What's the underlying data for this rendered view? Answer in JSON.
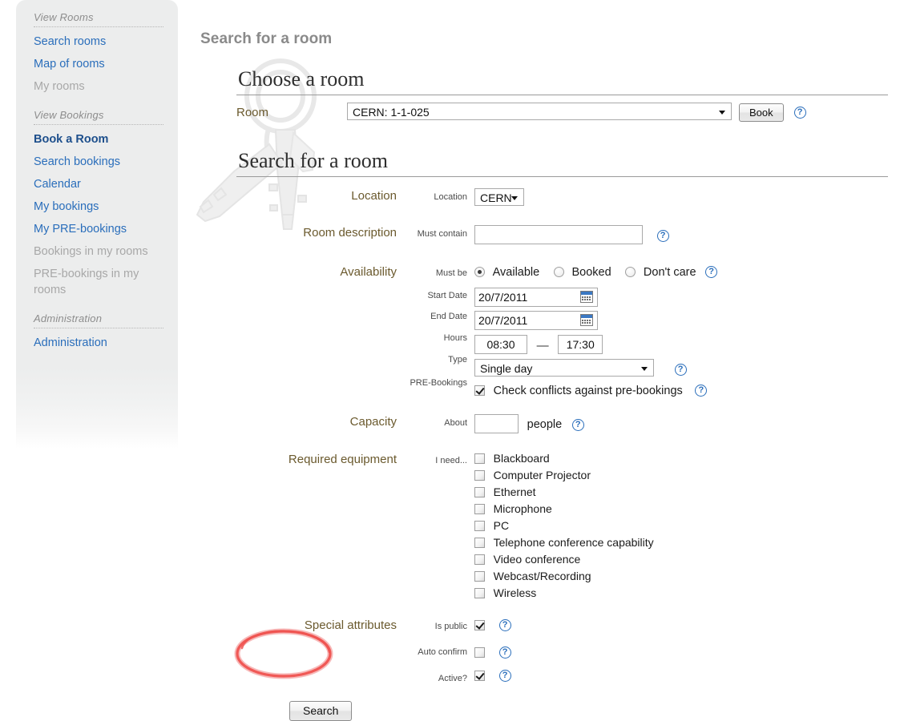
{
  "sidebar": {
    "groups": [
      {
        "title": "View Rooms",
        "items": [
          {
            "label": "Search rooms",
            "state": "link"
          },
          {
            "label": "Map of rooms",
            "state": "link"
          },
          {
            "label": "My rooms",
            "state": "disabled"
          }
        ]
      },
      {
        "title": "View Bookings",
        "items": [
          {
            "label": "Book a Room",
            "state": "current"
          },
          {
            "label": "Search bookings",
            "state": "link"
          },
          {
            "label": "Calendar",
            "state": "link"
          },
          {
            "label": "My bookings",
            "state": "link"
          },
          {
            "label": "My PRE-bookings",
            "state": "link"
          },
          {
            "label": "Bookings in my rooms",
            "state": "disabled"
          },
          {
            "label": "PRE-bookings in my rooms",
            "state": "disabled"
          }
        ]
      },
      {
        "title": "Administration",
        "items": [
          {
            "label": "Administration",
            "state": "link"
          }
        ]
      }
    ]
  },
  "page": {
    "title": "Search for a room"
  },
  "choose_room": {
    "heading": "Choose a room",
    "room_label": "Room",
    "room_value": "CERN:  1-1-025",
    "book_label": "Book",
    "help": "?"
  },
  "search_room": {
    "heading": "Search for a room",
    "rows": {
      "location": {
        "big_label": "Location",
        "small_label": "Location",
        "value": "CERN"
      },
      "room_description": {
        "big_label": "Room description",
        "small_label": "Must contain",
        "value": "",
        "placeholder": "",
        "help": "?"
      },
      "availability": {
        "big_label": "Availability",
        "must_be_label": "Must be",
        "options": [
          {
            "label": "Available",
            "selected": true
          },
          {
            "label": "Booked",
            "selected": false
          },
          {
            "label": "Don't care",
            "selected": false
          }
        ],
        "must_be_help": "?",
        "start_date_label": "Start Date",
        "start_date_value": "20/7/2011",
        "end_date_label": "End Date",
        "end_date_value": "20/7/2011",
        "hours_label": "Hours",
        "hours_from": "08:30",
        "hours_dash": "—",
        "hours_to": "17:30",
        "type_label": "Type",
        "type_value": "Single day",
        "type_help": "?",
        "prebookings_label": "PRE-Bookings",
        "prebookings_checkbox_label": "Check conflicts against pre-bookings",
        "prebookings_checked": true,
        "prebookings_help": "?"
      },
      "capacity": {
        "big_label": "Capacity",
        "small_label": "About",
        "value": "",
        "suffix": "people",
        "help": "?"
      },
      "equipment": {
        "big_label": "Required equipment",
        "small_label": "I need...",
        "items": [
          {
            "label": "Blackboard",
            "checked": false
          },
          {
            "label": "Computer Projector",
            "checked": false
          },
          {
            "label": "Ethernet",
            "checked": false
          },
          {
            "label": "Microphone",
            "checked": false
          },
          {
            "label": "PC",
            "checked": false
          },
          {
            "label": "Telephone conference capability",
            "checked": false
          },
          {
            "label": "Video conference",
            "checked": false
          },
          {
            "label": "Webcast/Recording",
            "checked": false
          },
          {
            "label": "Wireless",
            "checked": false
          }
        ]
      },
      "special_attributes": {
        "big_label": "Special attributes",
        "items": [
          {
            "label": "Is public",
            "checked": true,
            "help": "?"
          },
          {
            "label": "Auto confirm",
            "checked": false,
            "help": "?"
          },
          {
            "label": "Active?",
            "checked": true,
            "help": "?"
          }
        ]
      }
    },
    "search_button": "Search"
  },
  "annotation": {
    "shape": "red-ellipse-highlight",
    "color": "#ee5555",
    "target": "search-button"
  },
  "colors": {
    "link": "#2a6ebb",
    "sidebar_bg": "#eceded",
    "big_label": "#6b5a2e",
    "page_title": "#8a8a8a",
    "annotation_red": "#ee5555"
  }
}
